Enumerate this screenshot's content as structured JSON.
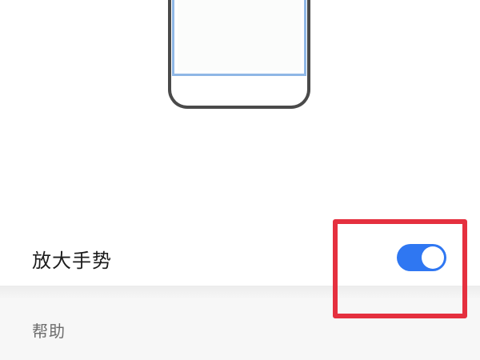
{
  "illustration": {
    "icon": "phone-screen-illustration"
  },
  "magnify_gesture": {
    "label": "放大手势",
    "enabled": true,
    "toggle_color": "#2f77f2"
  },
  "help_section": {
    "header": "帮助"
  },
  "annotation": {
    "highlight_color": "#e5303f"
  }
}
